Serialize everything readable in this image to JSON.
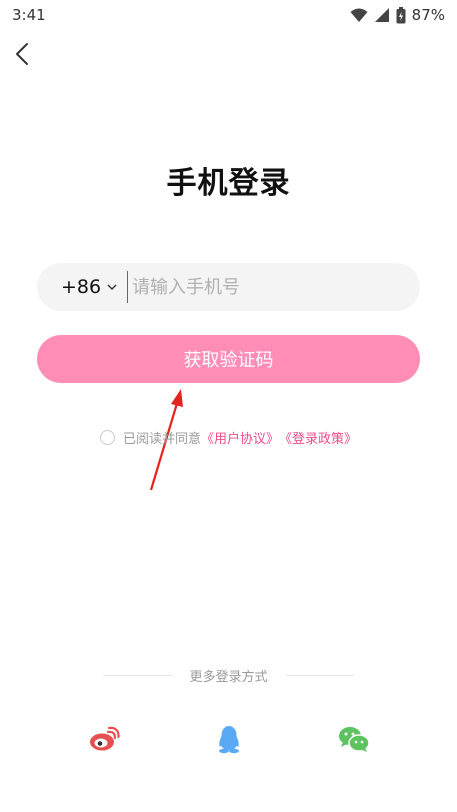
{
  "status_bar": {
    "time": "3:41",
    "battery": "87%",
    "icons": [
      "wifi-icon",
      "signal-icon",
      "battery-icon"
    ]
  },
  "nav": {
    "back_icon": "chevron-left-icon"
  },
  "page": {
    "title": "手机登录"
  },
  "phone": {
    "country_code": "+86",
    "placeholder": "请输入手机号",
    "value": ""
  },
  "get_code_button": {
    "label": "获取验证码",
    "color": "#ff8db6"
  },
  "agreement": {
    "prefix": "已阅读并同意",
    "user_agreement": "《用户协议》",
    "privacy_policy": "《登录政策》",
    "link_color": "#ef4d8b",
    "checked": false
  },
  "more_login": {
    "label": "更多登录方式",
    "options": [
      {
        "name": "weibo",
        "icon": "weibo-icon",
        "color": "#e8504f"
      },
      {
        "name": "qq",
        "icon": "qq-icon",
        "color": "#5aa9f5"
      },
      {
        "name": "wechat",
        "icon": "wechat-icon",
        "color": "#5cc35e"
      }
    ]
  }
}
